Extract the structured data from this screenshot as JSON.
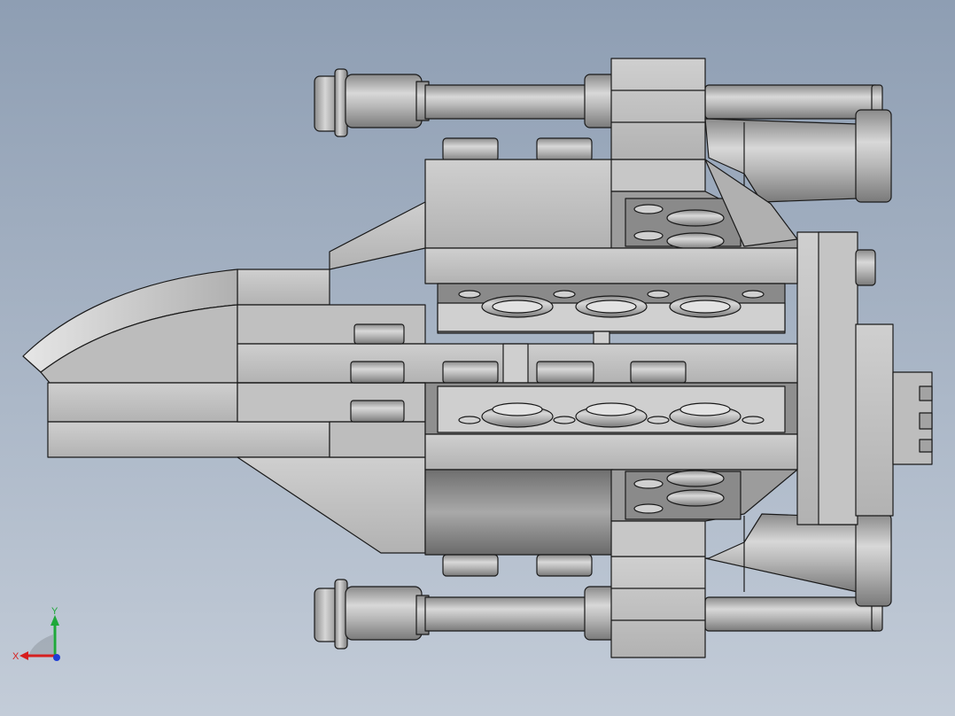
{
  "viewport": {
    "background_top": "#8e9eb3",
    "background_bottom": "#c3ccd8"
  },
  "model": {
    "shade_light": "#c9c9c9",
    "shade_mid": "#b4b4b4",
    "shade_dark": "#8f8f8f",
    "edge_color": "#1a1a1a"
  },
  "triad": {
    "x_label": "X",
    "y_label": "Y",
    "x_color": "#d61f1f",
    "y_color": "#1fa83a",
    "z_color": "#1f3fd6"
  }
}
